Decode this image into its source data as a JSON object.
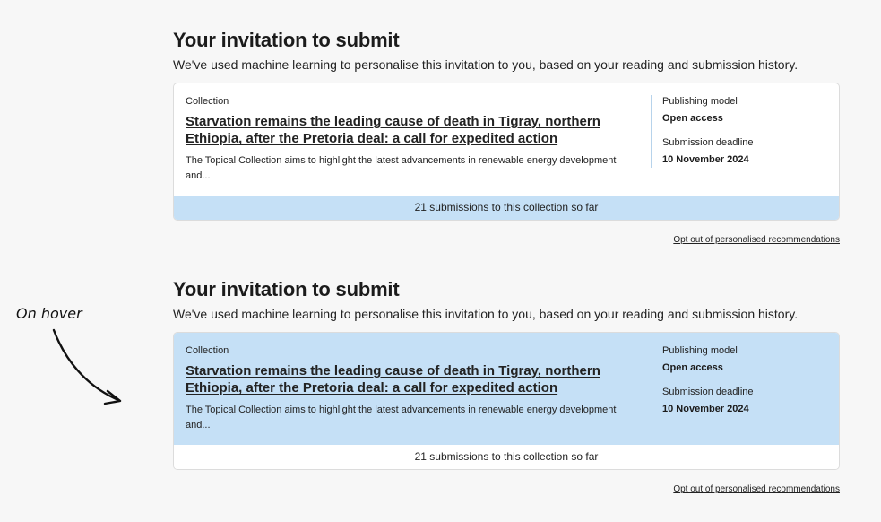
{
  "annotation": {
    "label": "On hover"
  },
  "sections": [
    {
      "state": "default",
      "heading": "Your invitation to submit",
      "intro": "We've used machine learning to personalise this invitation to you, based on your reading and submission history.",
      "card": {
        "kind": "Collection",
        "title": "Starvation remains the leading cause of death in Tigray, northern Ethiopia, after the Pretoria deal: a call for expedited action",
        "description": "The Topical Collection aims to highlight the latest advancements in renewable energy development and...",
        "publishing_model_label": "Publishing model",
        "publishing_model_value": "Open access",
        "deadline_label": "Submission deadline",
        "deadline_value": "10 November 2024",
        "footer": "21 submissions to this collection so far"
      },
      "optout": "Opt out of personalised recommendations"
    },
    {
      "state": "hover",
      "heading": "Your invitation to submit",
      "intro": "We've used machine learning to personalise this invitation to you, based on your reading and submission history.",
      "card": {
        "kind": "Collection",
        "title": "Starvation remains the leading cause of death in Tigray, northern Ethiopia, after the Pretoria deal: a call for expedited action",
        "description": "The Topical Collection aims to highlight the latest advancements in renewable energy development and...",
        "publishing_model_label": "Publishing model",
        "publishing_model_value": "Open access",
        "deadline_label": "Submission deadline",
        "deadline_value": "10 November 2024",
        "footer": "21 submissions to this collection so far"
      },
      "optout": "Opt out of personalised recommendations"
    }
  ],
  "colors": {
    "background": "#f7f7f7",
    "card_highlight": "#c5e0f6",
    "card_default": "#ffffff",
    "text": "#222222"
  }
}
